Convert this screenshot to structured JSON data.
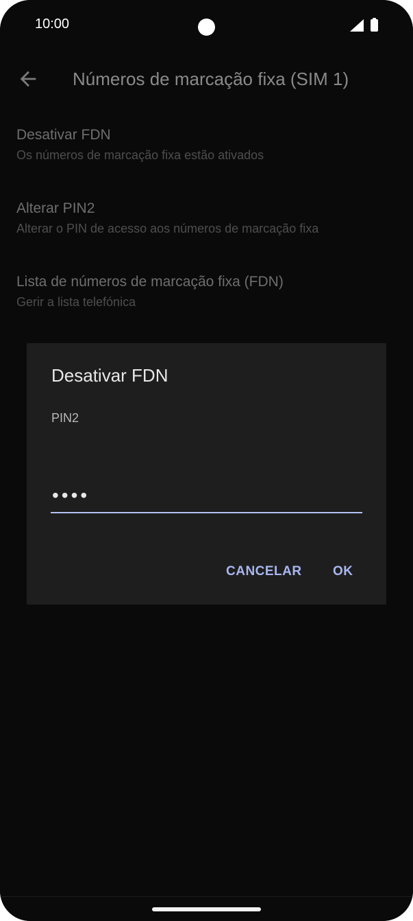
{
  "status_bar": {
    "time": "10:00",
    "icons": [
      "camera-cutout",
      "signal-icon",
      "battery-icon"
    ]
  },
  "toolbar": {
    "back_icon": "back-arrow-icon",
    "title": "Números de marcação fixa (SIM 1)"
  },
  "preferences": [
    {
      "title": "Desativar FDN",
      "summary": "Os números de marcação fixa estão ativados"
    },
    {
      "title": "Alterar PIN2",
      "summary": "Alterar o PIN de acesso aos números de marcação fixa"
    },
    {
      "title": "Lista de números de marcação fixa (FDN)",
      "summary": "Gerir a lista telefónica"
    }
  ],
  "dialog": {
    "title": "Desativar FDN",
    "field_label": "PIN2",
    "field_value": "••••",
    "cancel_label": "CANCELAR",
    "ok_label": "OK"
  },
  "colors": {
    "background": "#0a0a0a",
    "dialog_background": "#1e1e1e",
    "accent": "#a8b7f0",
    "underline": "#b5c3f5"
  }
}
